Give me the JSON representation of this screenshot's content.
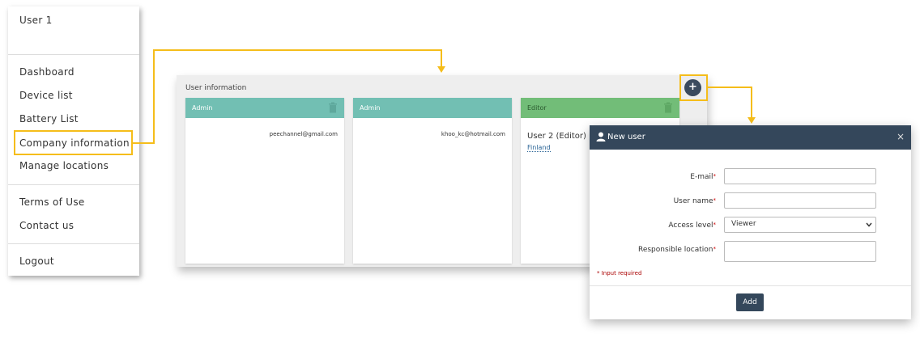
{
  "sidebar": {
    "user": "User 1",
    "items": [
      {
        "label": "Dashboard"
      },
      {
        "label": "Device list"
      },
      {
        "label": "Battery List"
      },
      {
        "label": "Company information"
      },
      {
        "label": "Manage locations"
      },
      {
        "label": "Terms of Use"
      },
      {
        "label": "Contact us"
      },
      {
        "label": "Logout"
      }
    ],
    "highlighted": "Company information"
  },
  "panel": {
    "title": "User information",
    "cards": [
      {
        "role": "Admin",
        "email": "peechannel@gmail.com",
        "color": "#72bfb3"
      },
      {
        "role": "Admin",
        "email": "khoo_kc@hotmail.com",
        "color": "#72bfb3"
      },
      {
        "role": "Editor",
        "name": "User 2 (Editor)",
        "location": "Finland",
        "color": "#72bd78"
      }
    ],
    "add_label": "+"
  },
  "modal": {
    "title": "New user",
    "close": "×",
    "fields": {
      "email": {
        "label": "E-mail",
        "value": ""
      },
      "username": {
        "label": "User name",
        "value": ""
      },
      "access": {
        "label": "Access level",
        "value": "Viewer"
      },
      "location": {
        "label": "Responsible location",
        "value": ""
      }
    },
    "required_marker": "*",
    "required_note": "* Input required",
    "submit_label": "Add"
  },
  "colors": {
    "highlight": "#f5bd1a",
    "modal_header": "#34475b",
    "admin_header": "#72bfb3",
    "editor_header": "#72bd78"
  }
}
